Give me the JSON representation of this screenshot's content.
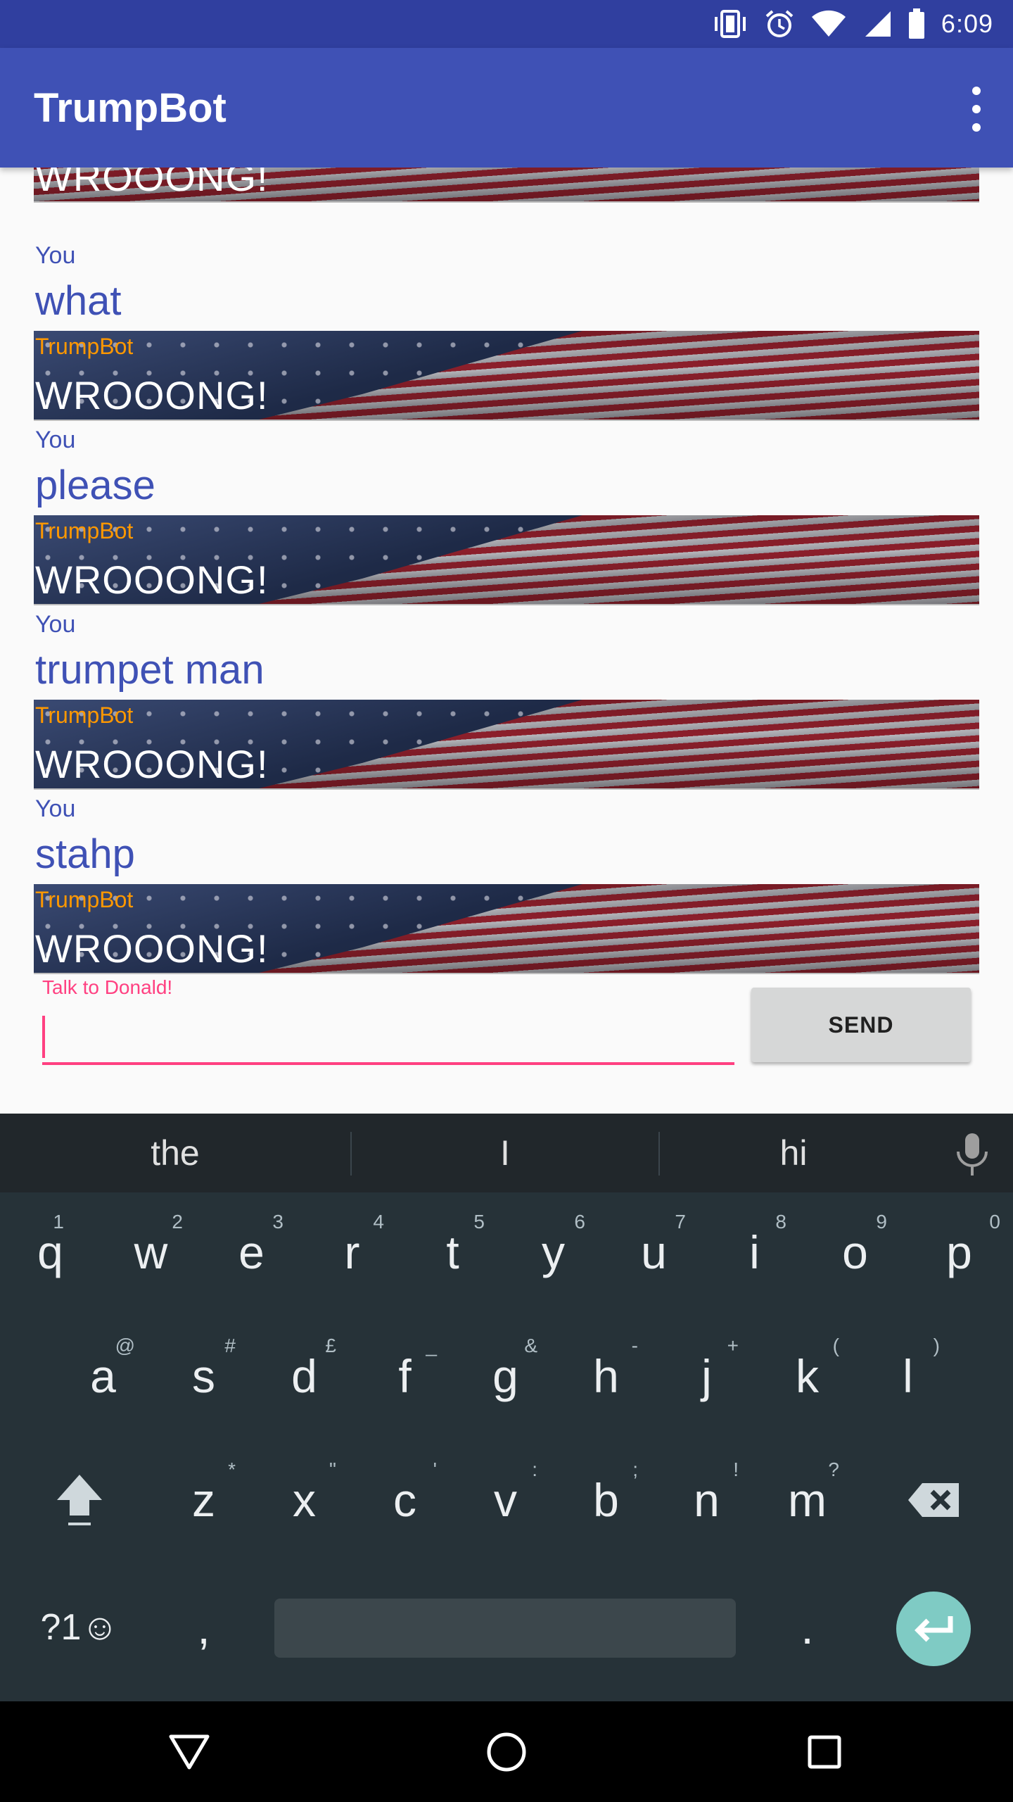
{
  "status_bar": {
    "time": "6:09",
    "icons": [
      "vibrate-icon",
      "alarm-icon",
      "wifi-icon",
      "signal-icon",
      "battery-icon"
    ]
  },
  "app_bar": {
    "title": "TrumpBot",
    "menu_icon": "overflow-menu-icon"
  },
  "messages": [
    {
      "sender": "",
      "text": "WROOONG!",
      "type": "bot"
    },
    {
      "sender": "You",
      "text": "what",
      "type": "user"
    },
    {
      "sender": "TrumpBot",
      "text": "WROOONG!",
      "type": "bot"
    },
    {
      "sender": "You",
      "text": "please",
      "type": "user"
    },
    {
      "sender": "TrumpBot",
      "text": "WROOONG!",
      "type": "bot"
    },
    {
      "sender": "You",
      "text": "trumpet man",
      "type": "user"
    },
    {
      "sender": "TrumpBot",
      "text": "WROOONG!",
      "type": "bot"
    },
    {
      "sender": "You",
      "text": "stahp",
      "type": "user"
    },
    {
      "sender": "TrumpBot",
      "text": "WROOONG!",
      "type": "bot"
    }
  ],
  "input": {
    "label": "Talk to Donald!",
    "value": "",
    "send_label": "SEND"
  },
  "keyboard": {
    "suggestions": [
      "the",
      "I",
      "hi"
    ],
    "row1": [
      {
        "key": "q",
        "hint": "1"
      },
      {
        "key": "w",
        "hint": "2"
      },
      {
        "key": "e",
        "hint": "3"
      },
      {
        "key": "r",
        "hint": "4"
      },
      {
        "key": "t",
        "hint": "5"
      },
      {
        "key": "y",
        "hint": "6"
      },
      {
        "key": "u",
        "hint": "7"
      },
      {
        "key": "i",
        "hint": "8"
      },
      {
        "key": "o",
        "hint": "9"
      },
      {
        "key": "p",
        "hint": "0"
      }
    ],
    "row2": [
      {
        "key": "a",
        "hint": "@"
      },
      {
        "key": "s",
        "hint": "#"
      },
      {
        "key": "d",
        "hint": "£"
      },
      {
        "key": "f",
        "hint": "_"
      },
      {
        "key": "g",
        "hint": "&"
      },
      {
        "key": "h",
        "hint": "-"
      },
      {
        "key": "j",
        "hint": "+"
      },
      {
        "key": "k",
        "hint": "("
      },
      {
        "key": "l",
        "hint": ")"
      }
    ],
    "row3": [
      {
        "key": "z",
        "hint": "*"
      },
      {
        "key": "x",
        "hint": "\""
      },
      {
        "key": "c",
        "hint": "'"
      },
      {
        "key": "v",
        "hint": ":"
      },
      {
        "key": "b",
        "hint": ";"
      },
      {
        "key": "n",
        "hint": "!"
      },
      {
        "key": "m",
        "hint": "?"
      }
    ],
    "symbols_label": "?1☺",
    "comma": ",",
    "period": "."
  },
  "nav_bar": {
    "back": "back-icon",
    "home": "home-icon",
    "recents": "recents-icon"
  }
}
